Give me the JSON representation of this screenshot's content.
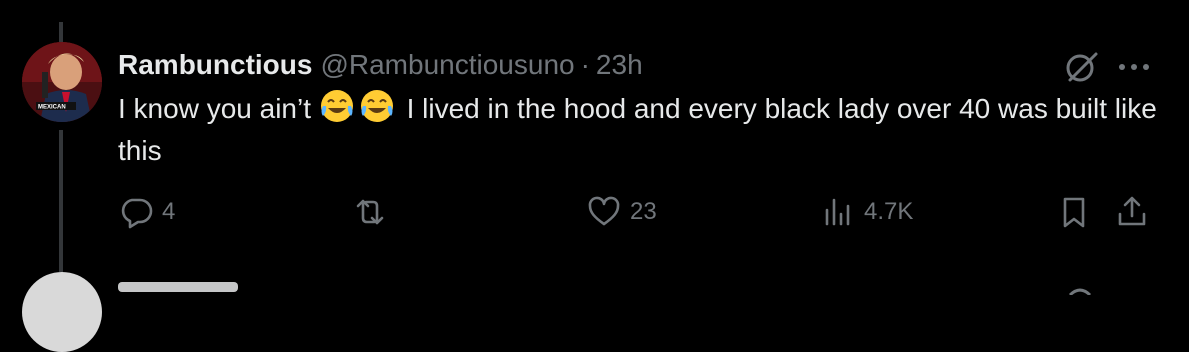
{
  "tweet": {
    "display_name": "Rambunctious",
    "handle": "@Rambunctiousuno",
    "separator": "·",
    "time": "23h",
    "avatar_text": "MEXICAN",
    "text_before": "I know you ain’t",
    "text_after": "I lived in the hood and every black lady over 40 was built like this",
    "emojis": [
      "face-with-tears-of-joy",
      "face-with-tears-of-joy"
    ]
  },
  "actions": {
    "reply_count": "4",
    "retweet_count": "",
    "like_count": "23",
    "views_count": "4.7K"
  },
  "colors": {
    "background": "#000000",
    "text_primary": "#e7e9ea",
    "text_secondary": "#71767b",
    "thread_line": "#333639"
  },
  "icons": [
    "grok-icon",
    "more-icon",
    "reply-icon",
    "retweet-icon",
    "like-icon",
    "views-icon",
    "bookmark-icon",
    "share-icon"
  ]
}
